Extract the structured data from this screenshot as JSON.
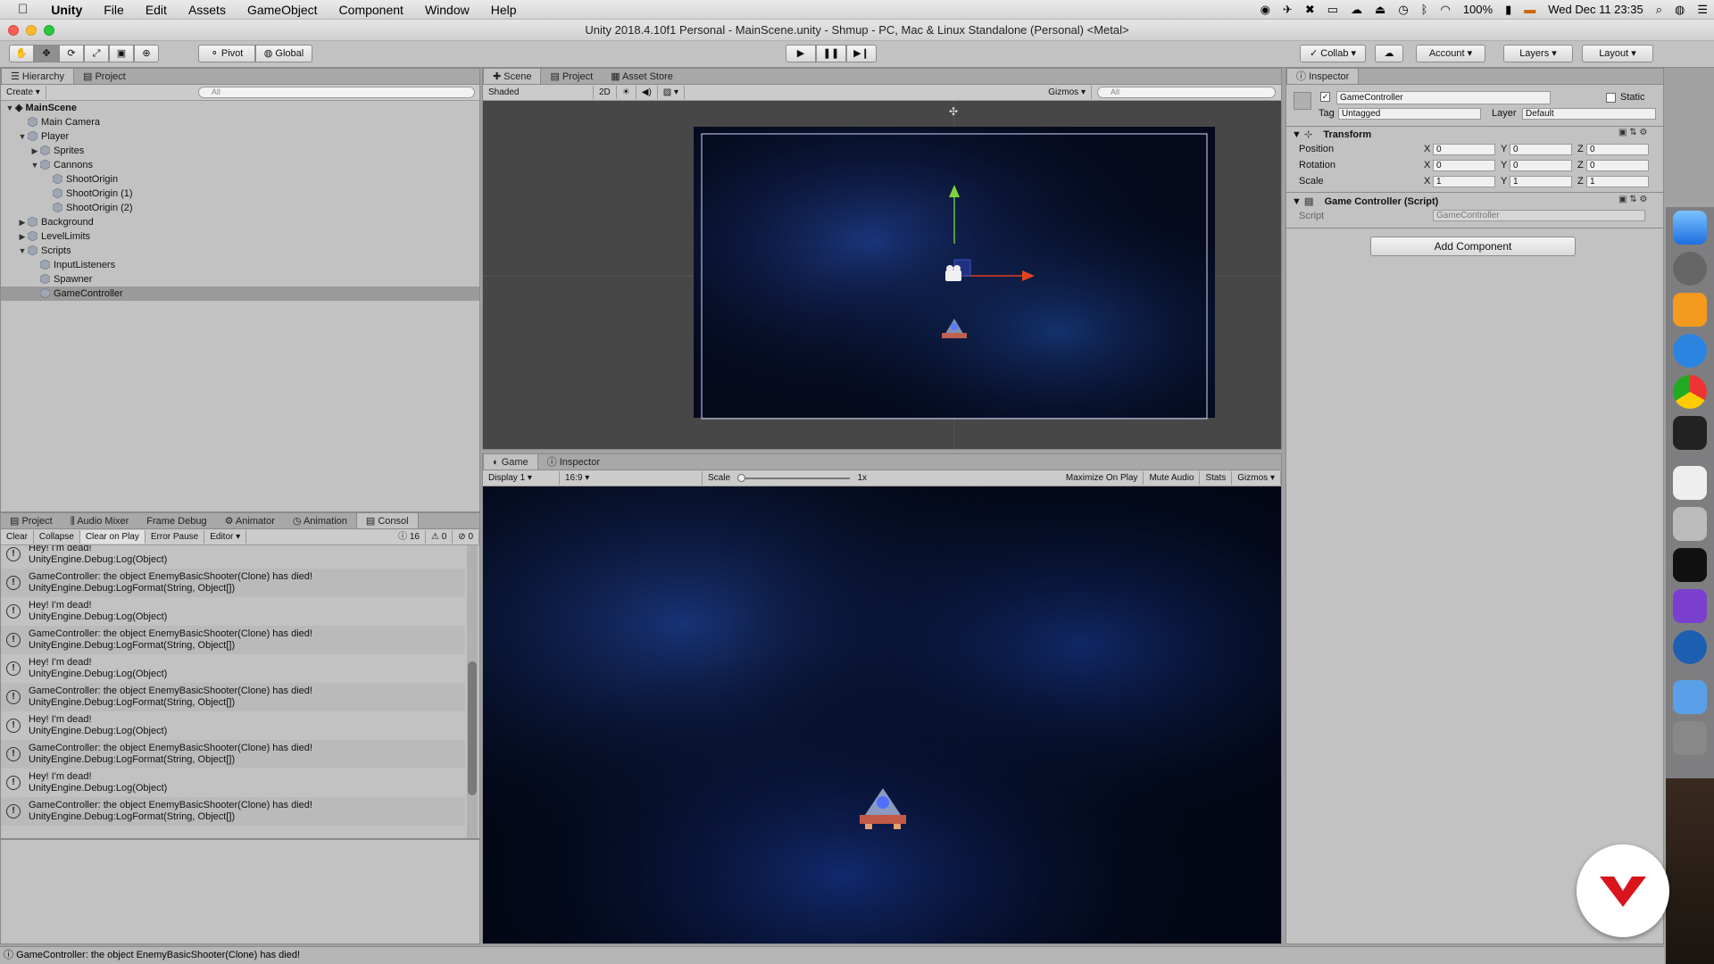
{
  "menubar": {
    "app": "Unity",
    "items": [
      "File",
      "Edit",
      "Assets",
      "GameObject",
      "Component",
      "Window",
      "Help"
    ],
    "battery": "100%",
    "datetime": "Wed Dec 11  23:35"
  },
  "window": {
    "title": "Unity 2018.4.10f1 Personal - MainScene.unity - Shmup - PC, Mac & Linux Standalone (Personal) <Metal>"
  },
  "toolbar": {
    "pivot": "Pivot",
    "global": "Global",
    "collab": "Collab",
    "account": "Account",
    "layers": "Layers",
    "layout": "Layout"
  },
  "hierarchy": {
    "tabs": [
      "Hierarchy",
      "Project"
    ],
    "create": "Create",
    "search_placeholder": "All",
    "scene": "MainScene",
    "items": [
      {
        "label": "Main Camera",
        "indent": 1,
        "arrow": ""
      },
      {
        "label": "Player",
        "indent": 1,
        "arrow": "down"
      },
      {
        "label": "Sprites",
        "indent": 2,
        "arrow": "right"
      },
      {
        "label": "Cannons",
        "indent": 2,
        "arrow": "down"
      },
      {
        "label": "ShootOrigin",
        "indent": 3,
        "arrow": ""
      },
      {
        "label": "ShootOrigin (1)",
        "indent": 3,
        "arrow": ""
      },
      {
        "label": "ShootOrigin (2)",
        "indent": 3,
        "arrow": ""
      },
      {
        "label": "Background",
        "indent": 1,
        "arrow": "right"
      },
      {
        "label": "LevelLimits",
        "indent": 1,
        "arrow": "right"
      },
      {
        "label": "Scripts",
        "indent": 1,
        "arrow": "down"
      },
      {
        "label": "InputListeners",
        "indent": 2,
        "arrow": ""
      },
      {
        "label": "Spawner",
        "indent": 2,
        "arrow": ""
      },
      {
        "label": "GameController",
        "indent": 2,
        "arrow": "",
        "selected": true
      }
    ]
  },
  "console": {
    "tabs": [
      "Project",
      "Audio Mixer",
      "Frame Debug",
      "Animator",
      "Animation",
      "Consol"
    ],
    "buttons": [
      "Clear",
      "Collapse",
      "Clear on Play",
      "Error Pause",
      "Editor"
    ],
    "count_info": "16",
    "count_warn": "0",
    "count_error": "0",
    "entries": [
      {
        "l1": "Hey! I'm dead!",
        "l2": "UnityEngine.Debug:Log(Object)"
      },
      {
        "l1": "GameController: the object EnemyBasicShooter(Clone) has died!",
        "l2": "UnityEngine.Debug:LogFormat(String, Object[])"
      },
      {
        "l1": "Hey! I'm dead!",
        "l2": "UnityEngine.Debug:Log(Object)"
      },
      {
        "l1": "GameController: the object EnemyBasicShooter(Clone) has died!",
        "l2": "UnityEngine.Debug:LogFormat(String, Object[])"
      },
      {
        "l1": "Hey! I'm dead!",
        "l2": "UnityEngine.Debug:Log(Object)"
      },
      {
        "l1": "GameController: the object EnemyBasicShooter(Clone) has died!",
        "l2": "UnityEngine.Debug:LogFormat(String, Object[])"
      },
      {
        "l1": "Hey! I'm dead!",
        "l2": "UnityEngine.Debug:Log(Object)"
      },
      {
        "l1": "GameController: the object EnemyBasicShooter(Clone) has died!",
        "l2": "UnityEngine.Debug:LogFormat(String, Object[])"
      },
      {
        "l1": "Hey! I'm dead!",
        "l2": "UnityEngine.Debug:Log(Object)"
      },
      {
        "l1": "GameController: the object EnemyBasicShooter(Clone) has died!",
        "l2": "UnityEngine.Debug:LogFormat(String, Object[])"
      }
    ]
  },
  "scene": {
    "tabs": [
      "Scene",
      "Project",
      "Asset Store"
    ],
    "shading": "Shaded",
    "mode2d": "2D",
    "gizmos": "Gizmos",
    "search_placeholder": "All"
  },
  "game": {
    "tabs": [
      "Game",
      "Inspector"
    ],
    "display": "Display 1",
    "aspect": "16:9",
    "scale_label": "Scale",
    "scale_value": "1x",
    "maximize": "Maximize On Play",
    "mute": "Mute Audio",
    "stats": "Stats",
    "gizmos": "Gizmos"
  },
  "inspector": {
    "tab": "Inspector",
    "object_name": "GameController",
    "static_label": "Static",
    "tag_label": "Tag",
    "tag_value": "Untagged",
    "layer_label": "Layer",
    "layer_value": "Default",
    "transform": {
      "title": "Transform",
      "rows": [
        {
          "label": "Position",
          "x": "0",
          "y": "0",
          "z": "0"
        },
        {
          "label": "Rotation",
          "x": "0",
          "y": "0",
          "z": "0"
        },
        {
          "label": "Scale",
          "x": "1",
          "y": "1",
          "z": "1"
        }
      ]
    },
    "script_component": {
      "title": "Game Controller (Script)",
      "script_label": "Script",
      "script_value": "GameController"
    },
    "add_component": "Add Component"
  },
  "statusbar": {
    "text": "GameController: the object EnemyBasicShooter(Clone) has died!"
  },
  "colors": {
    "accent_red": "#d9141b",
    "space_blue": "#0a1a55"
  }
}
